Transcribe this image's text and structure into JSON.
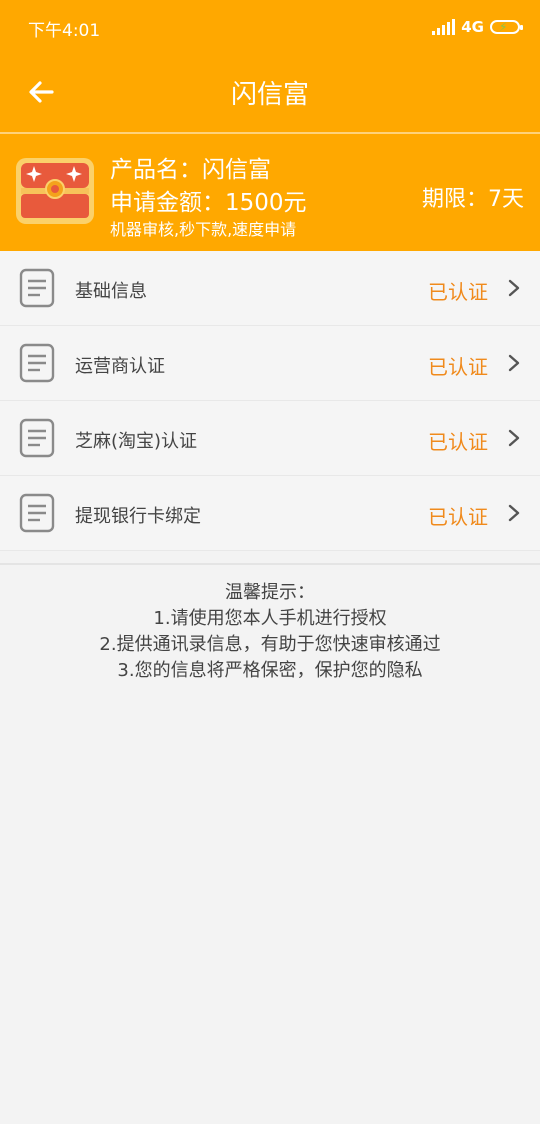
{
  "status_bar": {
    "time": "下午4:01",
    "network": "4G"
  },
  "header": {
    "title": "闪信富"
  },
  "product": {
    "name_line": "产品名：闪信富",
    "amount_line": "申请金额：1500元",
    "desc": "机器审核,秒下款,速度申请",
    "term": "期限：7天"
  },
  "items": [
    {
      "label": "基础信息",
      "status": "已认证"
    },
    {
      "label": "运营商认证",
      "status": "已认证"
    },
    {
      "label": "芝麻(淘宝)认证",
      "status": "已认证"
    },
    {
      "label": "提现银行卡绑定",
      "status": "已认证"
    }
  ],
  "tips": {
    "title": "温馨提示：",
    "lines": [
      "1.请使用您本人手机进行授权",
      "2.提供通讯录信息，有助于您快速审核通过",
      "3.您的信息将严格保密，保护您的隐私"
    ]
  },
  "colors": {
    "brand": "#FFA800",
    "status_text": "#F08A1C"
  },
  "icons": {
    "back": "arrow-left-icon",
    "chest": "treasure-chest-icon",
    "doc": "document-icon",
    "chevron": "chevron-right-icon"
  }
}
